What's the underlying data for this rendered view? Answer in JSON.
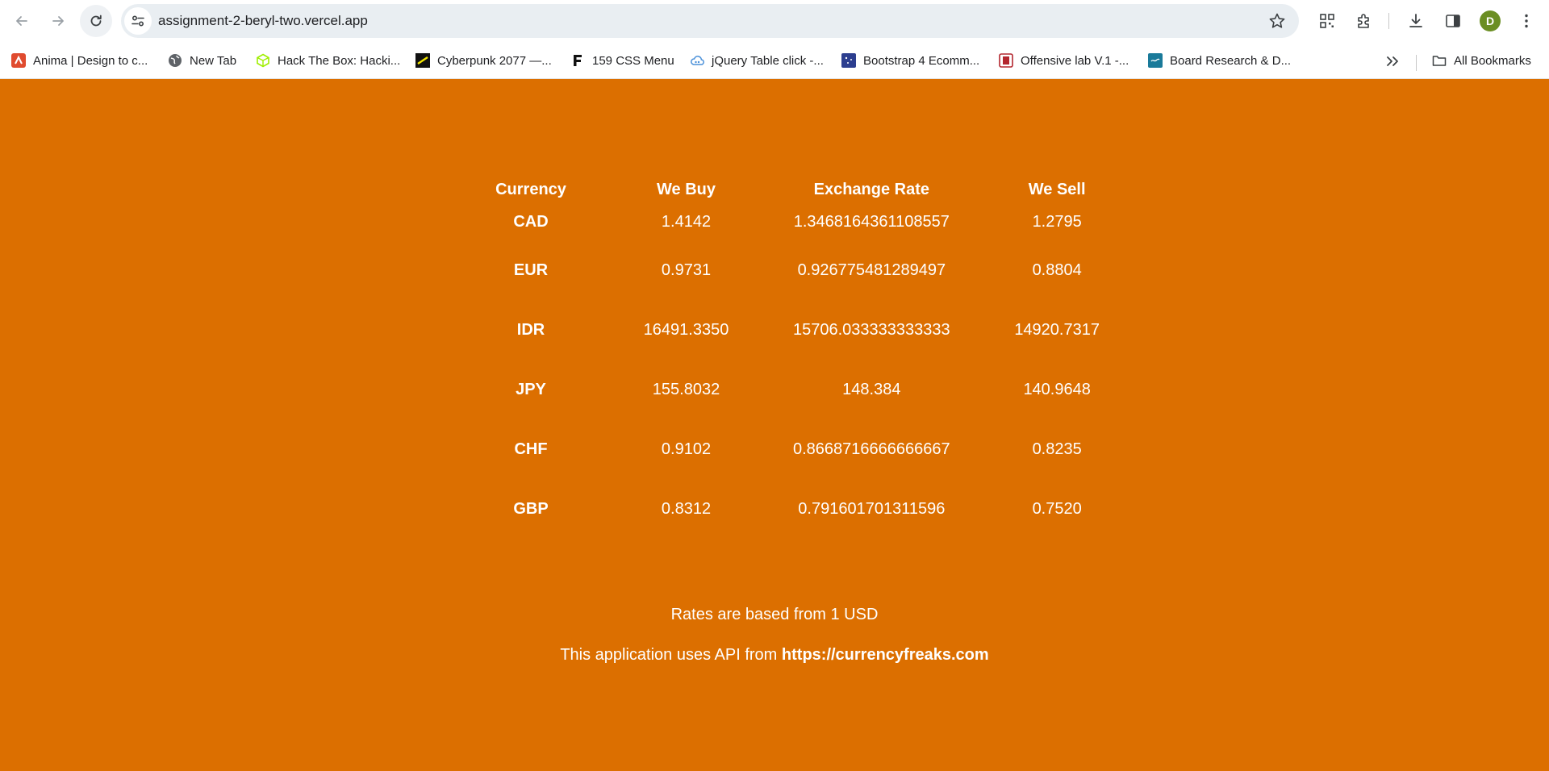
{
  "browser": {
    "url": "assignment-2-beryl-two.vercel.app",
    "profile_initial": "D",
    "profile_color": "#6b8e23"
  },
  "bookmarks": {
    "items": [
      {
        "label": "Anima | Design to c...",
        "icon": "anima-icon",
        "color": "#e04b2f"
      },
      {
        "label": "New Tab",
        "icon": "globe-icon",
        "color": "#5f6368"
      },
      {
        "label": "Hack The Box: Hacki...",
        "icon": "hackthebox-icon",
        "color": "#9fef00"
      },
      {
        "label": "Cyberpunk 2077 —...",
        "icon": "cyberpunk-icon",
        "color": "#f3e600"
      },
      {
        "label": "159 CSS Menu",
        "icon": "f-logo-icon",
        "color": "#111111"
      },
      {
        "label": "jQuery Table click -...",
        "icon": "cloud-icon",
        "color": "#4a90d9"
      },
      {
        "label": "Bootstrap 4 Ecomm...",
        "icon": "bootstrap-icon",
        "color": "#2c3e8f"
      },
      {
        "label": "Offensive lab V.1 -...",
        "icon": "offensive-lab-icon",
        "color": "#b3262e"
      },
      {
        "label": "Board Research & D...",
        "icon": "board-research-icon",
        "color": "#1a7a9a"
      }
    ],
    "all_bookmarks_label": "All Bookmarks"
  },
  "page": {
    "background": "#dc6f00",
    "table": {
      "headers": [
        "Currency",
        "We Buy",
        "Exchange Rate",
        "We Sell"
      ],
      "rows": [
        [
          "CAD",
          "1.4142",
          "1.3468164361108557",
          "1.2795"
        ],
        [
          "EUR",
          "0.9731",
          "0.926775481289497",
          "0.8804"
        ],
        [
          "IDR",
          "16491.3350",
          "15706.033333333333",
          "14920.7317"
        ],
        [
          "JPY",
          "155.8032",
          "148.384",
          "140.9648"
        ],
        [
          "CHF",
          "0.9102",
          "0.8668716666666667",
          "0.8235"
        ],
        [
          "GBP",
          "0.8312",
          "0.791601701311596",
          "0.7520"
        ]
      ]
    },
    "note_base": "Rates are based from 1 USD",
    "note_api_prefix": "This application uses API from ",
    "note_api_link": "https://currencyfreaks.com"
  }
}
